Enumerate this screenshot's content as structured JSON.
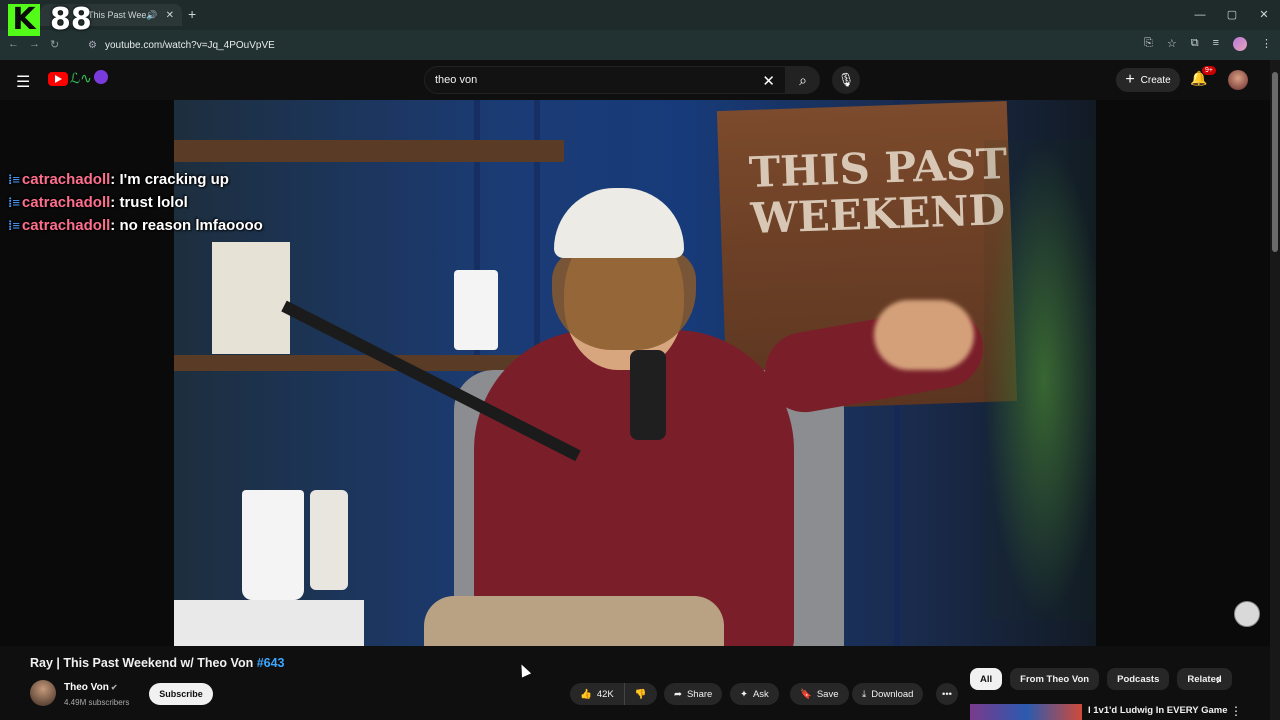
{
  "overlay": {
    "logo_letter": "K",
    "count": "88"
  },
  "browser": {
    "tab_title": "This Past Weeke",
    "url": "youtube.com/watch?v=Jq_4POuVpVE",
    "win_controls": [
      "—",
      "▢",
      "✕"
    ]
  },
  "header": {
    "search_value": "theo von",
    "create_label": "Create",
    "notification_count": "9+"
  },
  "chat": [
    {
      "user": "catrachadoll",
      "message": "I'm cracking up"
    },
    {
      "user": "catrachadoll",
      "message": "trust lolol"
    },
    {
      "user": "catrachadoll",
      "message": "no reason lmfaoooo"
    }
  ],
  "video_scene": {
    "sign_text": "THIS PAST WEEKEND"
  },
  "video": {
    "title": "Ray | This Past Weekend w/ Theo Von ",
    "tag": "#643",
    "channel": "Theo Von",
    "subscribers": "4.49M subscribers",
    "subscribe_label": "Subscribe",
    "likes": "42K",
    "share_label": "Share",
    "ask_label": "Ask",
    "save_label": "Save",
    "download_label": "Download"
  },
  "chips": [
    "All",
    "From Theo Von",
    "Podcasts",
    "Related"
  ],
  "recommendation": {
    "title": "I 1v1'd Ludwig In EVERY Game"
  },
  "icons": {
    "menu": "hamburger-icon",
    "search": "search-icon",
    "mic": "mic-icon",
    "bell": "bell-icon",
    "like": "thumbs-up-icon",
    "dislike": "thumbs-down-icon"
  },
  "colors": {
    "accent": "#3ea6ff",
    "chat_user": "#ff6f8d",
    "yt_red": "#ff0000",
    "kick_green": "#53fc18"
  }
}
